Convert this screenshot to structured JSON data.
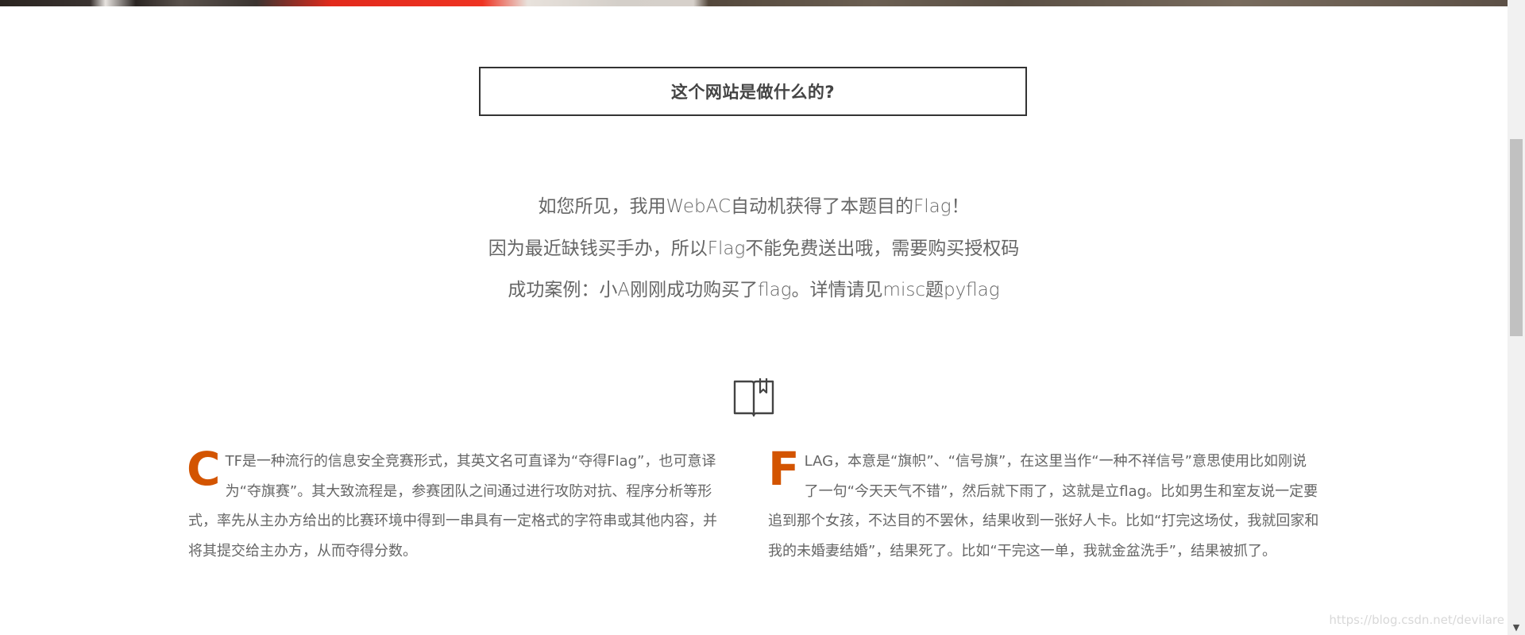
{
  "section": {
    "title": "这个网站是做什么的?"
  },
  "intro": {
    "lines": [
      "如您所见，我用WebAC自动机获得了本题目的Flag！",
      "因为最近缺钱买手办，所以Flag不能免费送出哦，需要购买授权码",
      "成功案例：小A刚刚成功购买了flag。详情请见misc题pyflag"
    ]
  },
  "icons": {
    "book": "book-icon"
  },
  "columns": {
    "left": {
      "dropcap": "C",
      "text": "TF是一种流行的信息安全竞赛形式，其英文名可直译为“夺得Flag”，也可意译为“夺旗赛”。其大致流程是，参赛团队之间通过进行攻防对抗、程序分析等形式，率先从主办方给出的比赛环境中得到一串具有一定格式的字符串或其他内容，并将其提交给主办方，从而夺得分数。"
    },
    "right": {
      "dropcap": "F",
      "text": "LAG，本意是“旗帜”、“信号旗”，在这里当作“一种不祥信号”意思使用比如刚说了一句“今天天气不错”，然后就下雨了，这就是立flag。比如男生和室友说一定要追到那个女孩，不达目的不罢休，结果收到一张好人卡。比如“打完这场仗，我就回家和我的未婚妻结婚”，结果死了。比如“干完这一单，我就金盆洗手”，结果被抓了。"
    }
  },
  "watermark": "https://blog.csdn.net/devilare",
  "colors": {
    "accent": "#d35400",
    "text": "#666666",
    "border": "#333333"
  }
}
